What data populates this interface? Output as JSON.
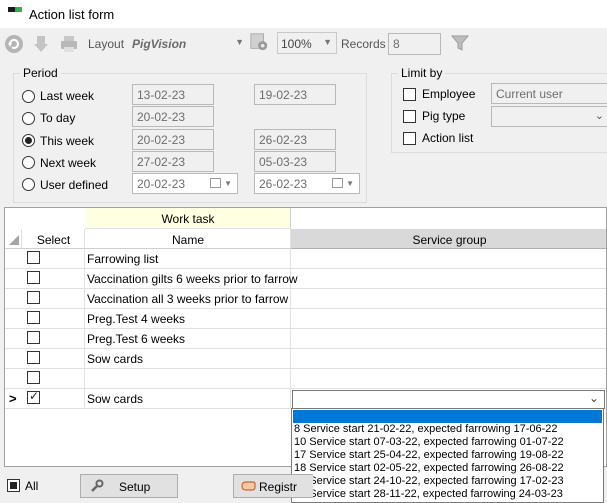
{
  "window": {
    "title": "Action list form"
  },
  "toolbar": {
    "layout_label": "Layout",
    "layout_value": "PigVision",
    "zoom_value": "100%",
    "records_label": "Records",
    "records_value": "8"
  },
  "period": {
    "caption": "Period",
    "options": [
      {
        "label": "Last week",
        "from": "13-02-23",
        "to": "19-02-23",
        "selected": false
      },
      {
        "label": "To day",
        "from": "20-02-23",
        "to": "",
        "selected": false
      },
      {
        "label": "This week",
        "from": "20-02-23",
        "to": "26-02-23",
        "selected": true
      },
      {
        "label": "Next week",
        "from": "27-02-23",
        "to": "05-03-23",
        "selected": false
      },
      {
        "label": "User defined",
        "from": "20-02-23",
        "to": "26-02-23",
        "selected": false
      }
    ]
  },
  "limit": {
    "caption": "Limit by",
    "employee_label": "Employee",
    "employee_value": "Current user",
    "pigtype_label": "Pig type",
    "pigtype_value": "",
    "actionlist_label": "Action list"
  },
  "grid": {
    "group_header": "Work task",
    "col_select": "Select",
    "col_name": "Name",
    "col_service": "Service group",
    "rows": [
      {
        "name": "Farrowing list",
        "checked": false
      },
      {
        "name": "Vaccination gilts 6 weeks prior to farrow",
        "checked": false
      },
      {
        "name": "Vaccination all 3 weeks prior to farrow",
        "checked": false
      },
      {
        "name": "Preg.Test 4 weeks",
        "checked": false
      },
      {
        "name": "Preg.Test 6 weeks",
        "checked": false
      },
      {
        "name": "Sow cards",
        "checked": false
      },
      {
        "name": "",
        "checked": false
      },
      {
        "name": "Sow cards",
        "checked": true
      }
    ],
    "current_row_marker": ">"
  },
  "service_dropdown": {
    "items": [
      "",
      "8 Service start 21-02-22, expected farrowing 17-06-22",
      "10 Service start 07-03-22, expected farrowing 01-07-22",
      "17 Service start 25-04-22, expected farrowing 19-08-22",
      "18 Service start 02-05-22, expected farrowing 26-08-22",
      "43 Service start 24-10-22, expected farrowing 17-02-23",
      "48 Service start 28-11-22, expected farrowing 24-03-23"
    ]
  },
  "bottom": {
    "all_label": "All",
    "setup_label": "Setup",
    "register_label": "Registr"
  },
  "colors": {
    "header_yellow": "#ffffe1",
    "service_header": "#d9d9d9",
    "selection_blue": "#0078d7"
  }
}
